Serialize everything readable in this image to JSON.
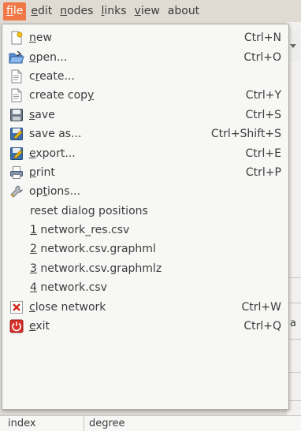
{
  "menubar": {
    "items": [
      {
        "mnemonic": "f",
        "rest": "ile"
      },
      {
        "mnemonic": "e",
        "rest": "dit"
      },
      {
        "mnemonic": "n",
        "rest": "odes"
      },
      {
        "mnemonic": "l",
        "rest": "inks"
      },
      {
        "mnemonic": "v",
        "rest": "iew"
      },
      {
        "mnemonic": "",
        "rest": "about"
      }
    ],
    "active_color": "#f07746"
  },
  "file_menu": {
    "items": [
      {
        "pre": "",
        "mn": "n",
        "post": "ew",
        "shortcut": "Ctrl+N",
        "icon": "new-document-icon"
      },
      {
        "pre": "",
        "mn": "o",
        "post": "pen...",
        "shortcut": "Ctrl+O",
        "icon": "open-folder-icon"
      },
      {
        "pre": "c",
        "mn": "r",
        "post": "eate...",
        "shortcut": "",
        "icon": "document-icon"
      },
      {
        "pre": "create cop",
        "mn": "y",
        "post": "",
        "shortcut": "Ctrl+Y",
        "icon": "document-icon"
      },
      {
        "pre": "",
        "mn": "s",
        "post": "ave",
        "shortcut": "Ctrl+S",
        "icon": "save-disk-icon"
      },
      {
        "pre": "save as...",
        "mn": "",
        "post": "",
        "shortcut": "Ctrl+Shift+S",
        "icon": "save-as-icon"
      },
      {
        "pre": "",
        "mn": "e",
        "post": "xport...",
        "shortcut": "Ctrl+E",
        "icon": "export-icon"
      },
      {
        "pre": "",
        "mn": "p",
        "post": "rint",
        "shortcut": "Ctrl+P",
        "icon": "printer-icon"
      },
      {
        "pre": "op",
        "mn": "t",
        "post": "ions...",
        "shortcut": "",
        "icon": "wrench-icon"
      },
      {
        "pre": "reset dialog positions",
        "mn": "",
        "post": "",
        "shortcut": "",
        "icon": ""
      },
      {
        "pre": "",
        "mn": "1",
        "post": " network_res.csv",
        "shortcut": "",
        "icon": ""
      },
      {
        "pre": "",
        "mn": "2",
        "post": " network.csv.graphml",
        "shortcut": "",
        "icon": ""
      },
      {
        "pre": "",
        "mn": "3",
        "post": " network.csv.graphmlz",
        "shortcut": "",
        "icon": ""
      },
      {
        "pre": "",
        "mn": "4",
        "post": " network.csv",
        "shortcut": "",
        "icon": ""
      },
      {
        "pre": "",
        "mn": "c",
        "post": "lose network",
        "shortcut": "Ctrl+W",
        "icon": "close-icon"
      },
      {
        "pre": "",
        "mn": "e",
        "post": "xit",
        "shortcut": "Ctrl+Q",
        "icon": "exit-icon"
      }
    ]
  },
  "background": {
    "edge_text": "a",
    "table_headers": [
      "index",
      "degree"
    ]
  }
}
